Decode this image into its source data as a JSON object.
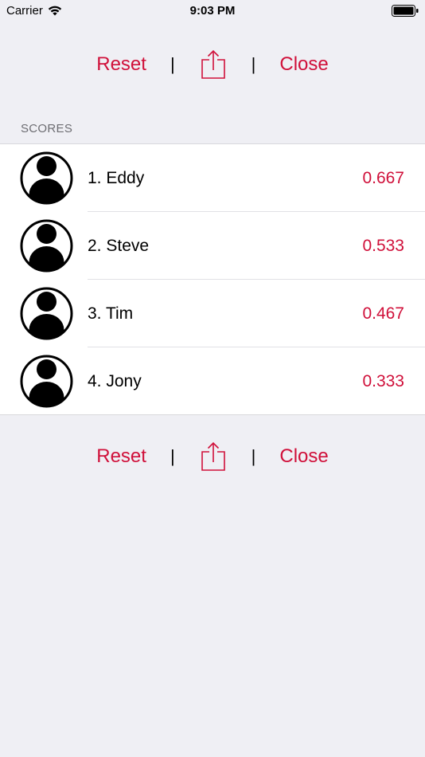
{
  "status_bar": {
    "carrier": "Carrier",
    "time": "9:03 PM"
  },
  "toolbar": {
    "reset_label": "Reset",
    "close_label": "Close",
    "separator": "|"
  },
  "scores": {
    "header": "SCORES",
    "items": [
      {
        "name": "1. Eddy",
        "score": "0.667"
      },
      {
        "name": "2. Steve",
        "score": "0.533"
      },
      {
        "name": "3. Tim",
        "score": "0.467"
      },
      {
        "name": "4. Jony",
        "score": "0.333"
      }
    ]
  },
  "colors": {
    "accent": "#d0103a",
    "background": "#efeff4"
  }
}
